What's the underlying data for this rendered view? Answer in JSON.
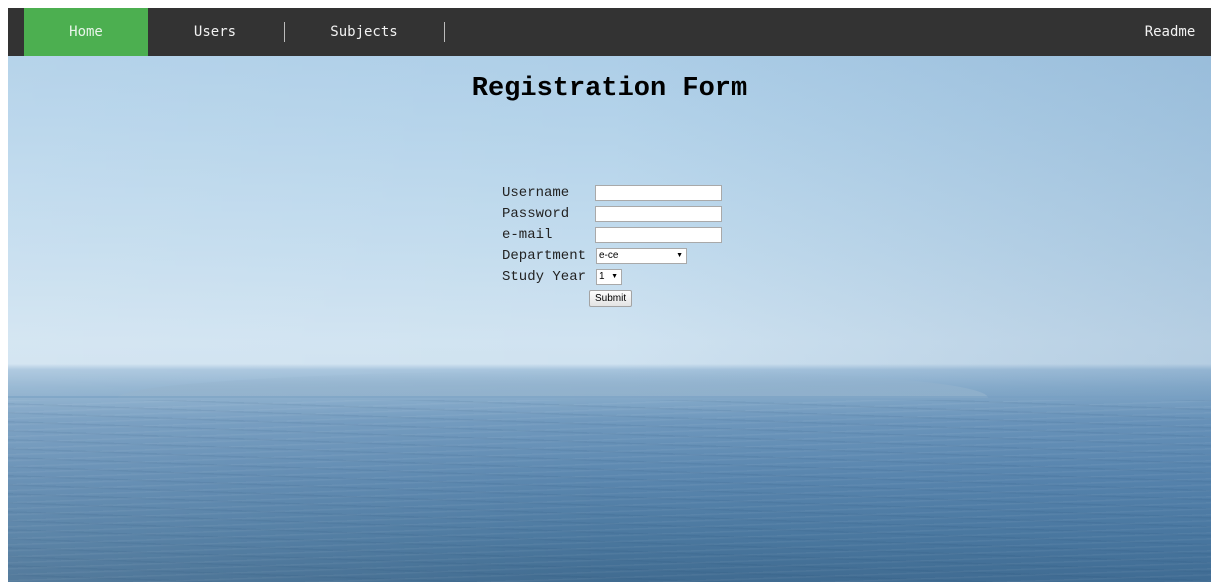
{
  "nav": {
    "home": "Home",
    "users": "Users",
    "subjects": "Subjects",
    "readme": "Readme"
  },
  "page": {
    "title": "Registration Form"
  },
  "form": {
    "username_label": "Username",
    "password_label": "Password",
    "email_label": "e-mail",
    "department_label": "Department",
    "department_value": "e-ce",
    "study_year_label": "Study Year",
    "study_year_value": "1",
    "submit_label": "Submit"
  },
  "colors": {
    "nav_background": "#333333",
    "nav_active": "#4caf50"
  }
}
